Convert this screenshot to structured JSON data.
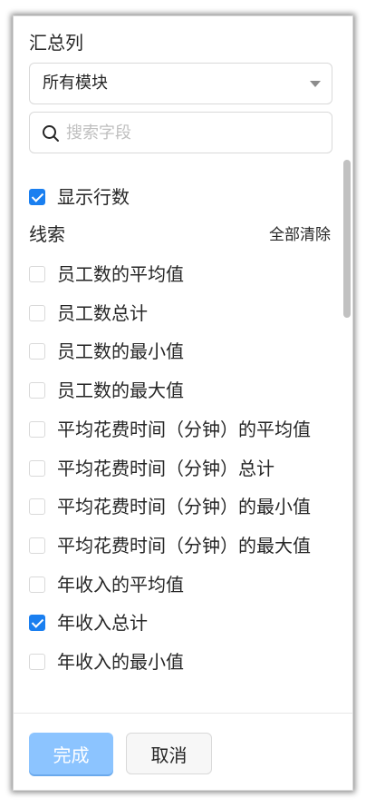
{
  "panel": {
    "title": "汇总列",
    "module_select": {
      "value": "所有模块"
    },
    "search": {
      "placeholder": "搜索字段",
      "value": ""
    },
    "show_row_count": {
      "label": "显示行数",
      "checked": true
    },
    "clues": {
      "title": "线索",
      "clear_all_label": "全部清除",
      "items": [
        {
          "label": "员工数的平均值",
          "checked": false
        },
        {
          "label": "员工数总计",
          "checked": false
        },
        {
          "label": "员工数的最小值",
          "checked": false
        },
        {
          "label": "员工数的最大值",
          "checked": false
        },
        {
          "label": "平均花费时间（分钟）的平均值",
          "checked": false
        },
        {
          "label": "平均花费时间（分钟）总计",
          "checked": false
        },
        {
          "label": "平均花费时间（分钟）的最小值",
          "checked": false
        },
        {
          "label": "平均花费时间（分钟）的最大值",
          "checked": false
        },
        {
          "label": "年收入的平均值",
          "checked": false
        },
        {
          "label": "年收入总计",
          "checked": true
        },
        {
          "label": "年收入的最小值",
          "checked": false
        }
      ]
    },
    "footer": {
      "done_label": "完成",
      "cancel_label": "取消"
    }
  },
  "colors": {
    "accent": "#1a7ff0",
    "done_button_disabled": "#8cc4ff",
    "border": "#d9d9d9"
  },
  "icons": {
    "search": "search-icon",
    "caret": "chevron-down-icon",
    "check": "check-icon"
  }
}
